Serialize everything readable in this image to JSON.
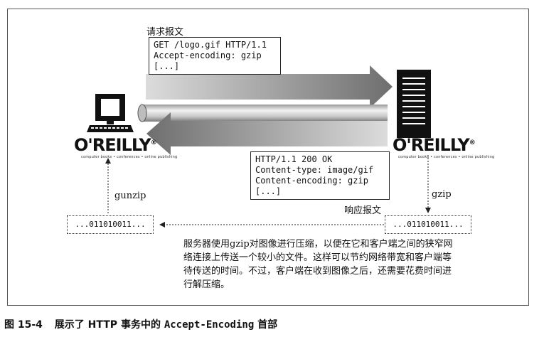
{
  "request": {
    "label": "请求报文",
    "lines": [
      "GET /logo.gif HTTP/1.1",
      "Accept-encoding: gzip",
      "[...]"
    ]
  },
  "response": {
    "label": "响应报文",
    "lines": [
      "HTTP/1.1 200 OK",
      "Content-type: image/gif",
      "Content-encoding: gzip",
      "[...]"
    ]
  },
  "client": {
    "logo": "O'REILLY",
    "tagline": "computer books • conferences • online publishing"
  },
  "server": {
    "logo": "O'REILLY",
    "tagline": "computer books • conferences • online publishing"
  },
  "left_step": "gunzip",
  "right_step": "gzip",
  "left_data": "...011010011...",
  "right_data": "...011010011...",
  "description": "服务器使用gzip对图像进行压缩，以便在它和客户端之间的狭窄网络连接上传送一个较小的文件。这样可以节约网络带宽和客户端等待传送的时间。不过，客户端在收到图像之后，还需要花费时间进行解压缩。",
  "caption": {
    "number": "图 15-4",
    "text_before": "展示了 HTTP 事务中的",
    "header": "Accept-Encoding",
    "text_after": "首部"
  },
  "colors": {
    "arrow": "#8c8c8c",
    "pipe": "#cfcfcf",
    "ink": "#111111"
  },
  "icons": [
    "computer-icon",
    "server-icon"
  ]
}
